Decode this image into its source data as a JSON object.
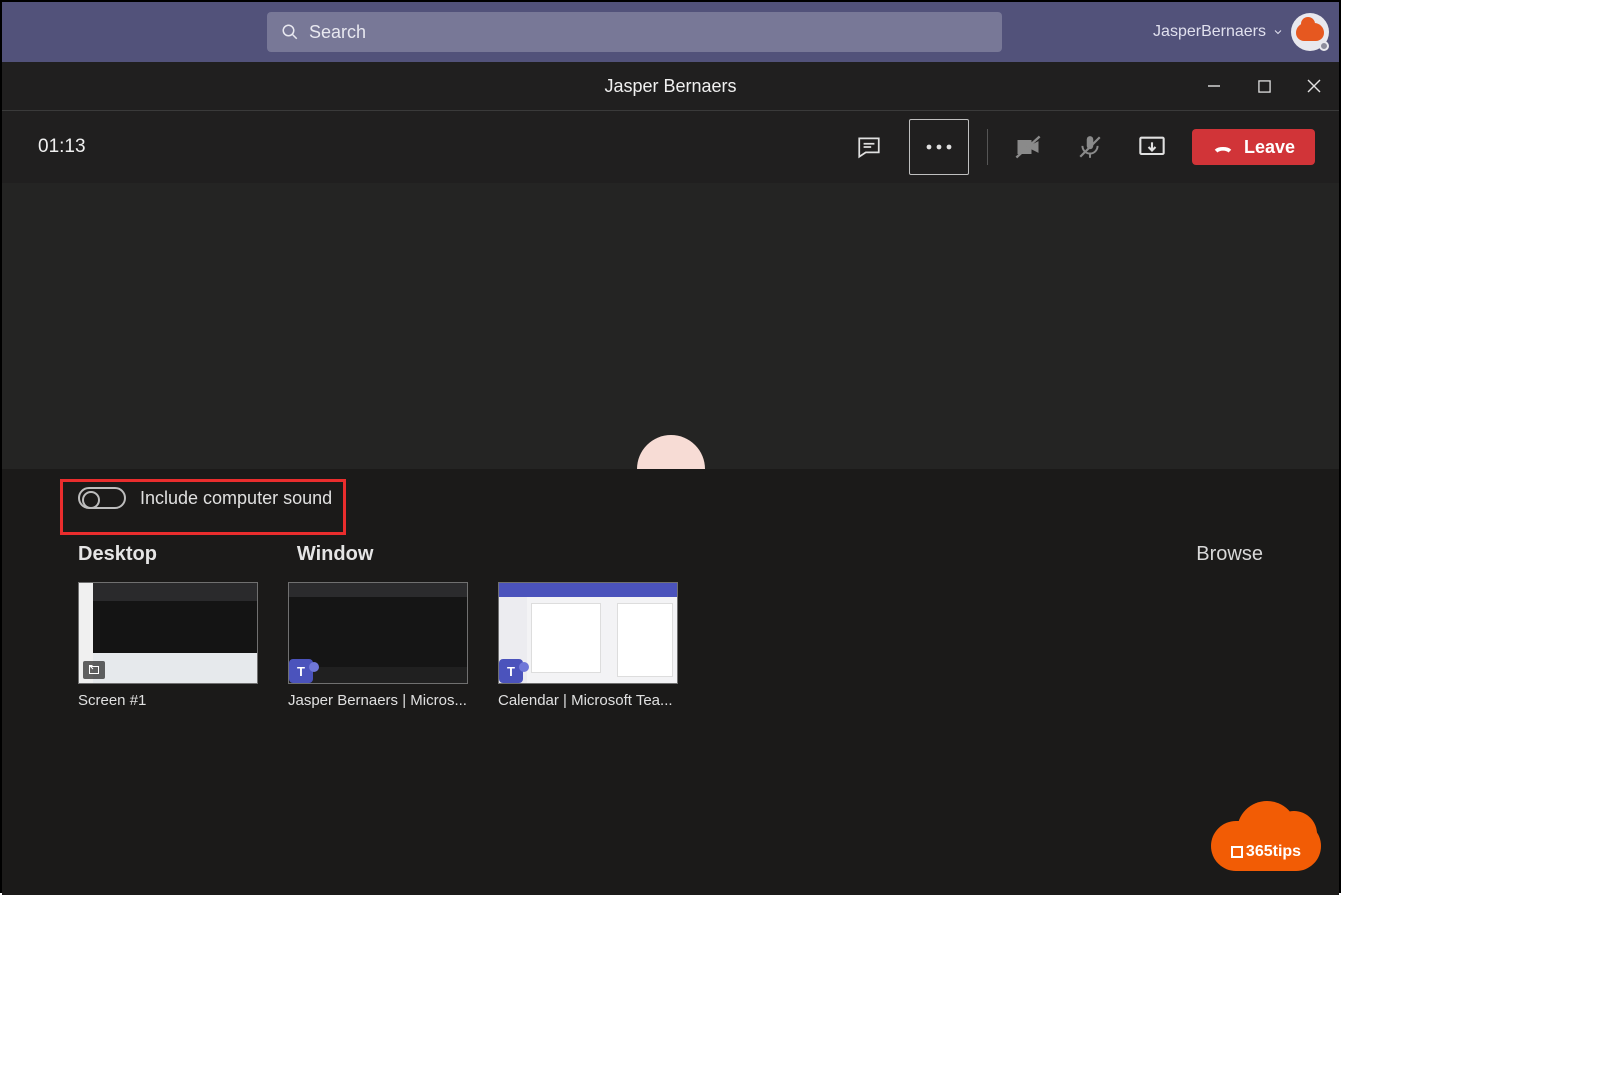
{
  "top": {
    "search_placeholder": "Search",
    "user_name": "JasperBernaers"
  },
  "call": {
    "title": "Jasper Bernaers",
    "timer": "01:13",
    "leave_label": "Leave"
  },
  "share": {
    "toggle_label": "Include computer sound",
    "tab_desktop": "Desktop",
    "tab_window": "Window",
    "browse": "Browse",
    "thumbs": [
      {
        "label": "Screen #1"
      },
      {
        "label": "Jasper Bernaers | Micros..."
      },
      {
        "label": "Calendar | Microsoft Tea..."
      }
    ]
  },
  "watermark": "365tips"
}
